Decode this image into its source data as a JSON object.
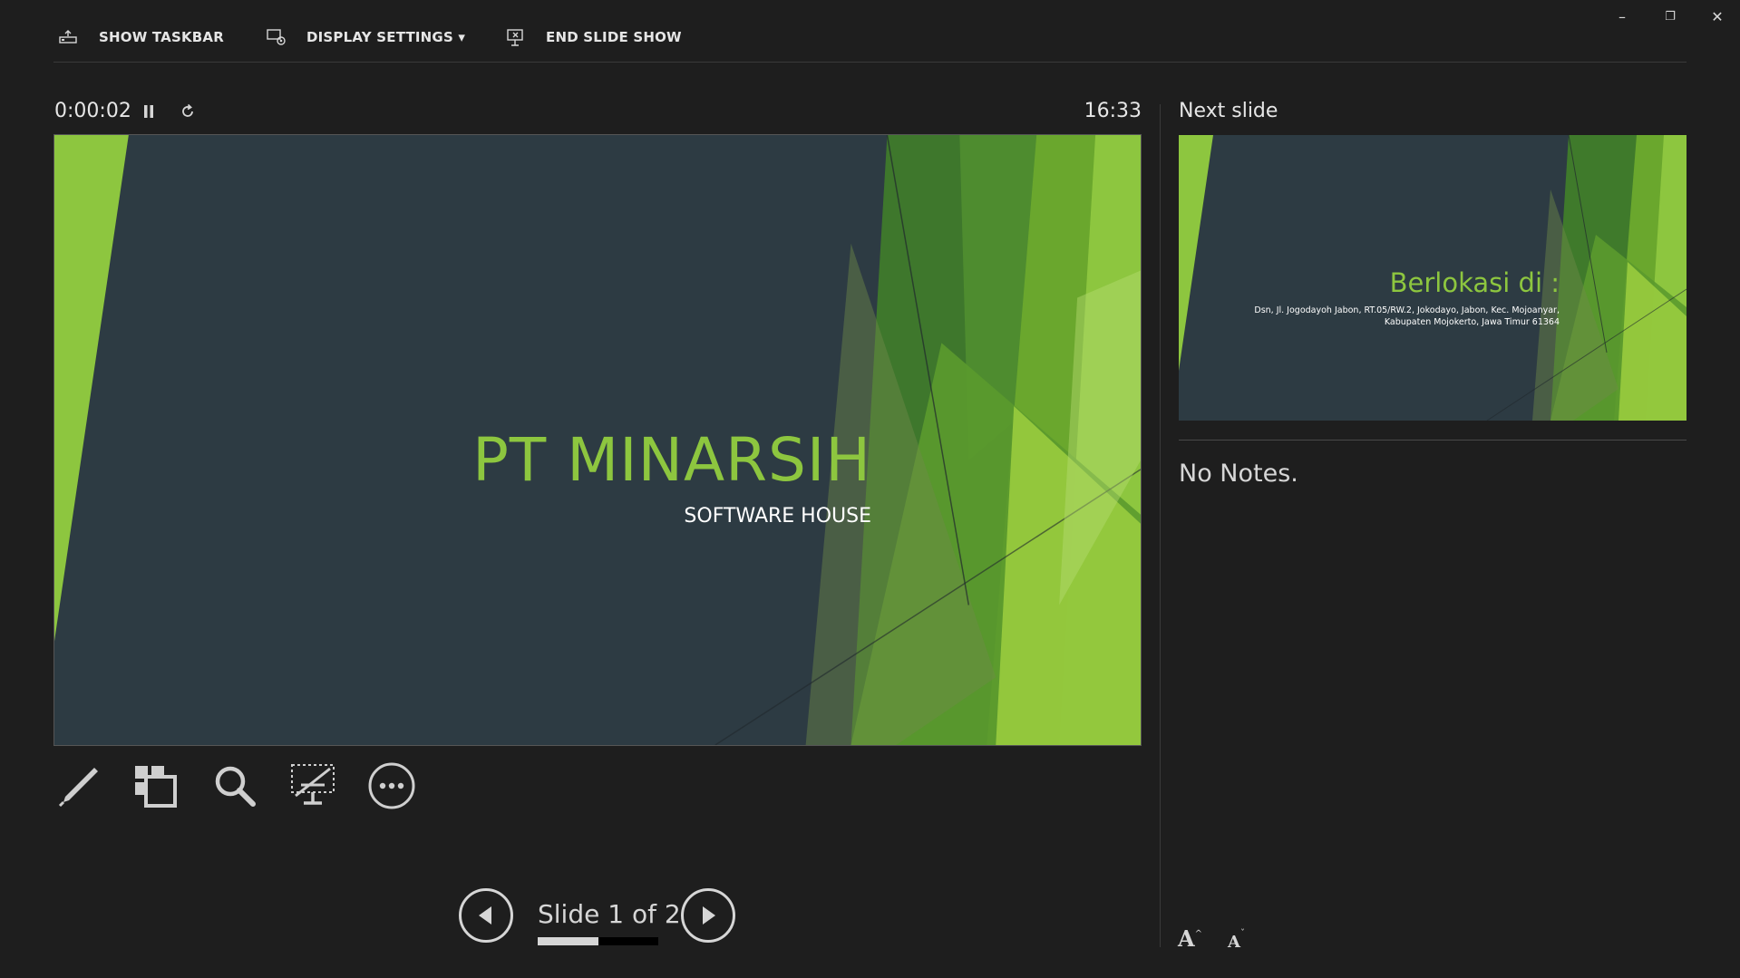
{
  "toolbar": {
    "show_taskbar": "SHOW TASKBAR",
    "display_settings": "DISPLAY SETTINGS ▾",
    "end_slide_show": "END SLIDE SHOW"
  },
  "window_controls": {
    "minimize": "–",
    "restore": "❐",
    "close": "✕"
  },
  "timer": {
    "elapsed": "0:00:02",
    "clock": "16:33"
  },
  "current_slide": {
    "title": "PT MINARSIH",
    "subtitle": "SOFTWARE HOUSE"
  },
  "tools": [
    "pen-icon",
    "see-all-slides-icon",
    "zoom-icon",
    "black-screen-icon",
    "more-options-icon"
  ],
  "navigation": {
    "counter": "Slide 1 of 2",
    "current": 1,
    "total": 2,
    "progress_fraction": 0.5
  },
  "next_slide": {
    "label": "Next slide",
    "title": "Berlokasi di :",
    "body_line1": "Dsn, Jl. Jogodayoh Jabon, RT.05/RW.2, Jokodayo, Jabon, Kec. Mojoanyar,",
    "body_line2": "Kabupaten Mojokerto, Jawa Timur 61364"
  },
  "notes": {
    "text": "No Notes."
  },
  "font_controls": {
    "increase": "A",
    "decrease": "A"
  },
  "colors": {
    "background": "#1e1e1e",
    "slide_bg": "#2d3b43",
    "accent_green": "#8dc63f"
  }
}
